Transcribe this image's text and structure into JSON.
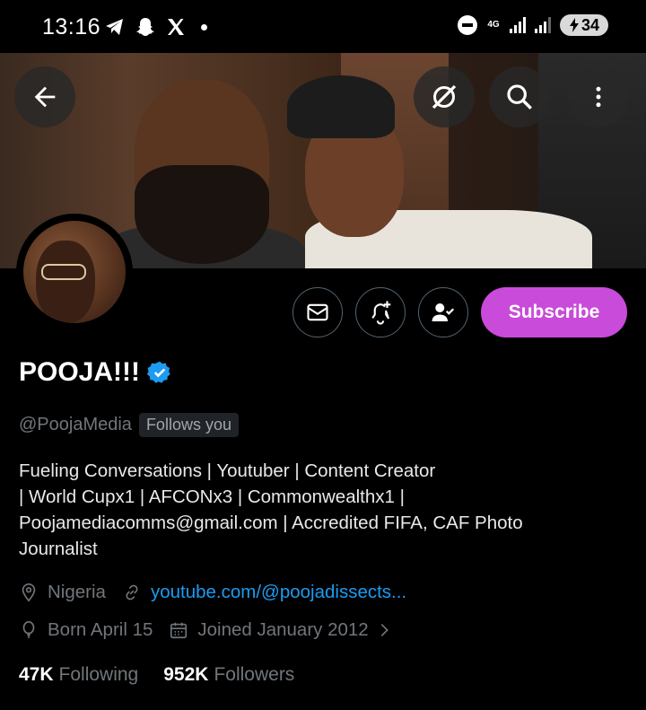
{
  "status_bar": {
    "time": "13:16",
    "network": "4G",
    "battery": "34",
    "left_icons": [
      "telegram-icon",
      "snapchat-icon",
      "x-icon",
      "notification-dot"
    ]
  },
  "header": {
    "back_icon": "arrow-left-icon",
    "grok_icon": "grok-icon",
    "search_icon": "search-icon",
    "more_icon": "more-vertical-icon"
  },
  "actions": {
    "message_icon": "mail-icon",
    "notify_icon": "bell-plus-icon",
    "following_icon": "person-check-icon",
    "subscribe_label": "Subscribe",
    "subscribe_color": "#c94bd9"
  },
  "profile": {
    "name": "POOJA!!!",
    "verified": true,
    "handle": "@PoojaMedia",
    "follows_you": "Follows you",
    "bio_lines": [
      "Fueling Conversations | Youtuber | Content Creator",
      "| World Cupx1 | AFCONx3 | Commonwealthx1 |",
      "Poojamediacomms@gmail.com | Accredited FIFA, CAF Photo",
      "Journalist"
    ],
    "location": "Nigeria",
    "website": "youtube.com/@poojadissects...",
    "birthday": "Born April 15",
    "joined": "Joined January 2012",
    "following_count": "47K",
    "following_label": "Following",
    "followers_count": "952K",
    "followers_label": "Followers"
  },
  "colors": {
    "background": "#000000",
    "link": "#1d9bf0",
    "muted": "#71767b",
    "verified": "#1d9bf0"
  }
}
